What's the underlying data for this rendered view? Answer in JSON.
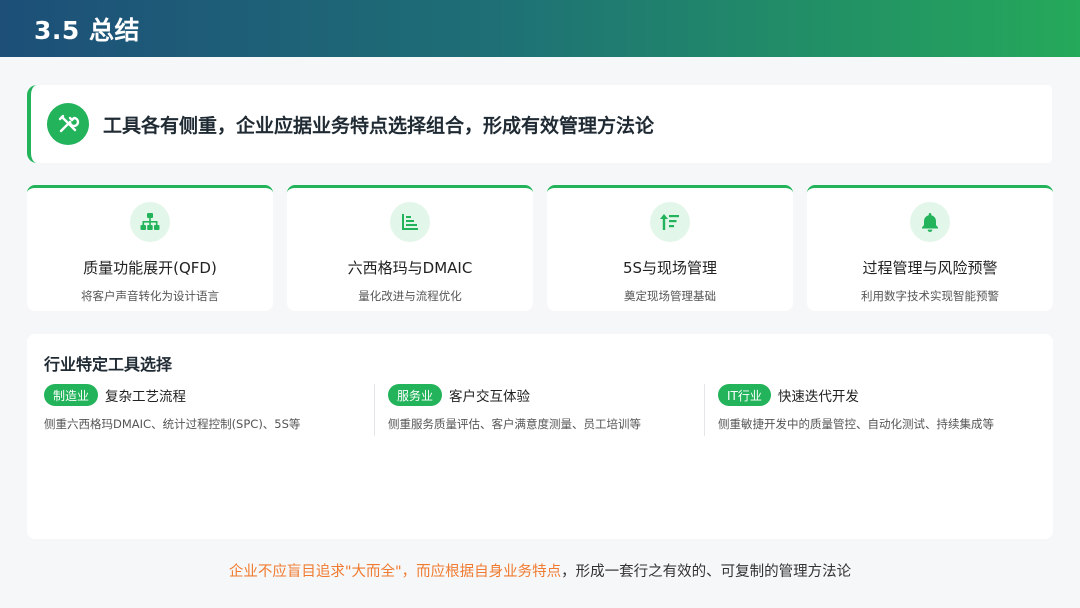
{
  "header": {
    "title": "3.5 总结"
  },
  "banner": {
    "icon": "tools-icon",
    "text": "工具各有侧重，企业应据业务特点选择组合，形成有效管理方法论"
  },
  "cards": [
    {
      "icon": "hierarchy-icon",
      "title": "质量功能展开(QFD)",
      "subtitle": "将客户声音转化为设计语言"
    },
    {
      "icon": "sort-list-icon",
      "title": "六西格玛与DMAIC",
      "subtitle": "量化改进与流程优化"
    },
    {
      "icon": "sort-arrows-icon",
      "title": "5S与现场管理",
      "subtitle": "奠定现场管理基础"
    },
    {
      "icon": "bell-icon",
      "title": "过程管理与风险预警",
      "subtitle": "利用数字技术实现智能预警"
    }
  ],
  "industry": {
    "title": "行业特定工具选择",
    "items": [
      {
        "tag": "制造业",
        "name": "复杂工艺流程",
        "desc": "侧重六西格玛DMAIC、统计过程控制(SPC)、5S等"
      },
      {
        "tag": "服务业",
        "name": "客户交互体验",
        "desc": "侧重服务质量评估、客户满意度测量、员工培训等"
      },
      {
        "tag": "IT行业",
        "name": "快速迭代开发",
        "desc": "侧重敏捷开发中的质量管控、自动化测试、持续集成等"
      }
    ]
  },
  "footer": {
    "highlight": "企业不应盲目追求\"大而全\"，而应根据自身业务特点",
    "rest": "，形成一套行之有效的、可复制的管理方法论"
  },
  "colors": {
    "accent": "#22b35b",
    "highlight": "#f07b30",
    "header_start": "#1d4f78",
    "header_end": "#25a95a"
  }
}
